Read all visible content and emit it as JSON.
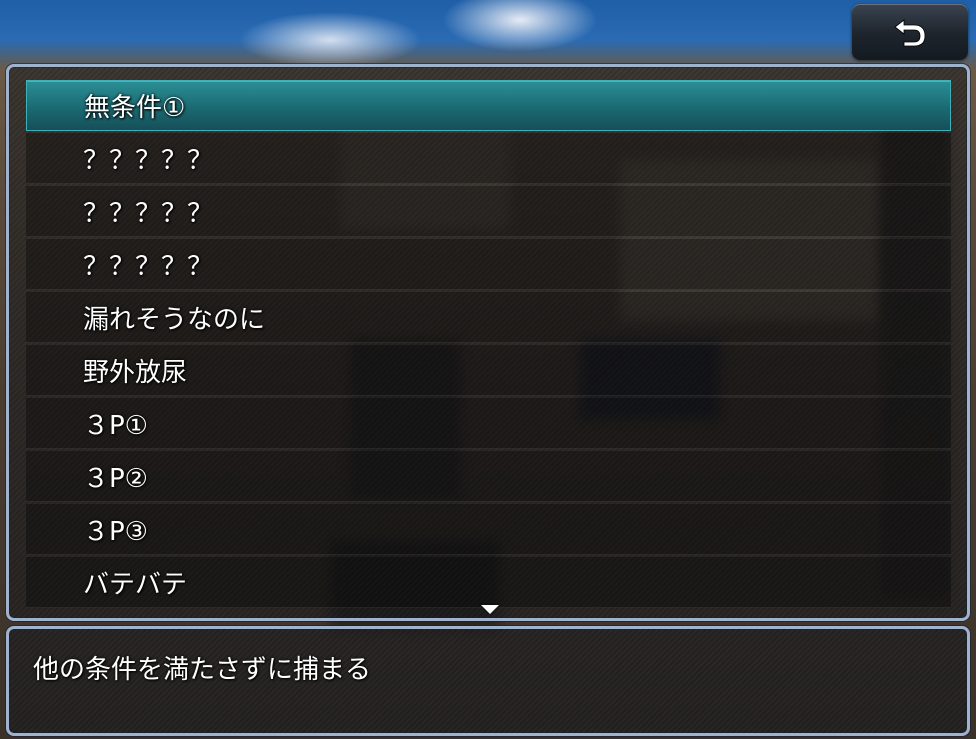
{
  "back_button": {
    "icon": "return-arrow-icon"
  },
  "menu": {
    "selected_index": 0,
    "items": [
      {
        "label": "無条件①"
      },
      {
        "label": "？？？？？"
      },
      {
        "label": "？？？？？"
      },
      {
        "label": "？？？？？"
      },
      {
        "label": "漏れそうなのに"
      },
      {
        "label": "野外放尿"
      },
      {
        "label": "３P①"
      },
      {
        "label": "３P②"
      },
      {
        "label": "３P③"
      },
      {
        "label": "バテバテ"
      }
    ],
    "more_indicator_icon": "scroll-down-arrow-icon"
  },
  "help": {
    "text": "他の条件を満たさずに捕まる"
  },
  "colors": {
    "window_border": "#9fb3cf",
    "selection": "#1f7b83",
    "text": "#ffffff"
  }
}
